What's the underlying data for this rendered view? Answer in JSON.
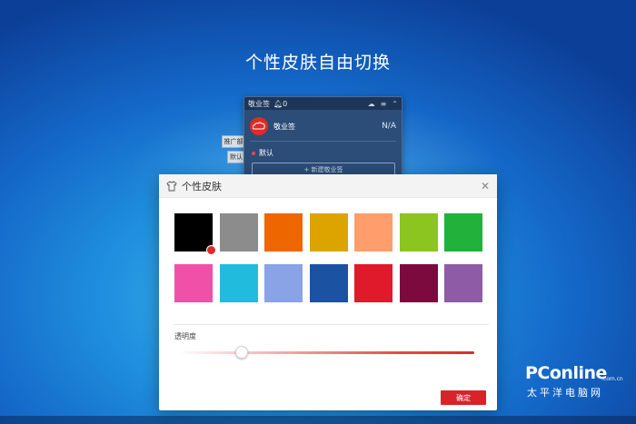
{
  "headline": "个性皮肤自由切换",
  "note_app": {
    "title": "敬业签",
    "bell_count": "0",
    "app_name": "敬业签",
    "status": "N/A",
    "default_label": "默认",
    "new_button": "+ 新建敬业签",
    "side_tab_1": "推广部",
    "side_tab_2": "默认"
  },
  "dialog": {
    "title": "个性皮肤",
    "swatch_colors": [
      "#000000",
      "#8c8c8c",
      "#ee6600",
      "#dda400",
      "#ff9e6c",
      "#8cc520",
      "#22b13a",
      "#f050a8",
      "#21bbdd",
      "#8aa2e6",
      "#1b52a2",
      "#e01a2a",
      "#7d0a3f",
      "#8e5ca6"
    ],
    "selected_index": 0,
    "opacity_label": "透明度",
    "opacity_value": 0.22,
    "confirm_label": "确定"
  },
  "watermark": {
    "brand": "PConline",
    "domain": ".com.cn",
    "sub": "太平洋电脑网"
  }
}
